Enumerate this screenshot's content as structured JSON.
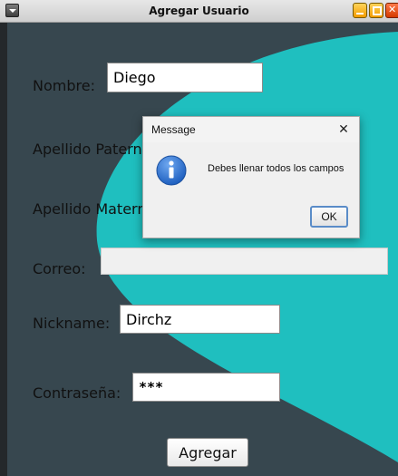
{
  "window": {
    "title": "Agregar Usuario"
  },
  "colors": {
    "panel_background": "#37474f",
    "accent_curve": "#1fbfbf",
    "titlebar_minimize": "#f2a500",
    "titlebar_maximize": "#f2a500",
    "titlebar_close": "#e04a10"
  },
  "form": {
    "nombre_label": "Nombre:",
    "nombre_value": "Diego",
    "apellido_paterno_label": "Apellido Paterno:",
    "apellido_materno_label": "Apellido Materno:",
    "correo_label": "Correo:",
    "correo_value": "",
    "nickname_label": "Nickname:",
    "nickname_value": "Dirchz",
    "password_label": "Contraseña:",
    "password_value": "***",
    "submit_label": "Agregar"
  },
  "dialog": {
    "title": "Message",
    "close_glyph": "✕",
    "message": "Debes llenar todos los campos",
    "ok_label": "OK",
    "icon": "info-icon"
  }
}
